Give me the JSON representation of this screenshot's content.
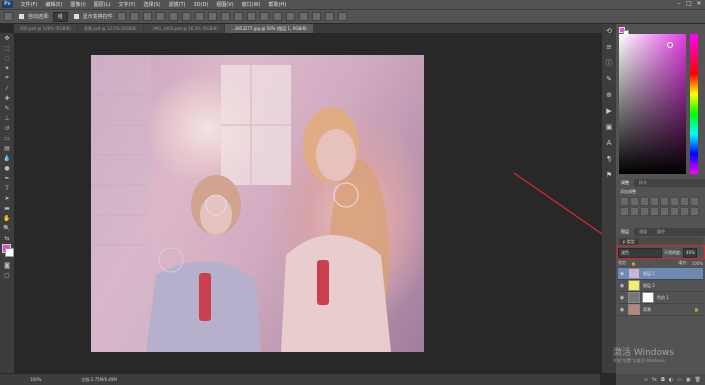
{
  "app": {
    "logo": "Ps"
  },
  "menu": [
    "文件(F)",
    "编辑(E)",
    "图像(I)",
    "图层(L)",
    "文字(Y)",
    "选择(S)",
    "滤镜(T)",
    "3D(D)",
    "视图(V)",
    "窗口(W)",
    "帮助(H)"
  ],
  "window_controls": [
    "–",
    "□",
    "✕"
  ],
  "options": {
    "auto_select_label": "自动选择:",
    "auto_select_value": "组",
    "show_transform": "显示变换控件"
  },
  "tabs": [
    {
      "label": "005.psd @ 100% (RGB/8)",
      "active": false
    },
    {
      "label": "背景.psd @ 12.5% (RGB/8)",
      "active": false
    },
    {
      "label": "...IMG_3403.psd @ 16.2% (RGB/8)",
      "active": false
    },
    {
      "label": "...3853277.jpg @ 50% (图层 1, RGB/8)",
      "active": true
    }
  ],
  "status": {
    "zoom": "100%",
    "doc_info": "文档:2.75M/6.49M"
  },
  "panels": {
    "color_tabs": [
      "颜色",
      "色板"
    ],
    "adjust_tabs": [
      "调整",
      "样式"
    ],
    "adjust_label": "添加调整",
    "layers_tabs": [
      "图层",
      "通道",
      "路径"
    ],
    "filter_kind": "p 类型",
    "blend_mode": "滤色",
    "opacity_label": "不透明度:",
    "opacity_value": "40%",
    "lock_label": "锁定:",
    "fill_label": "填充:",
    "fill_value": "100%",
    "layers": [
      {
        "name": "图层 1",
        "selected": true,
        "thumb": "#c7b4d8"
      },
      {
        "name": "图层 2",
        "selected": false,
        "thumb": "#f3ef6a"
      },
      {
        "name": "色阶 1",
        "selected": false,
        "thumb": "#777777"
      },
      {
        "name": "背景",
        "selected": false,
        "thumb": "#b58a7a"
      }
    ]
  },
  "colors": {
    "foreground": "#e34ae0",
    "background": "#ffffff",
    "annotation": "#d9272e"
  },
  "watermark": {
    "line1": "激活 Windows",
    "line2": "转到\"设置\"以激活 Windows。"
  }
}
